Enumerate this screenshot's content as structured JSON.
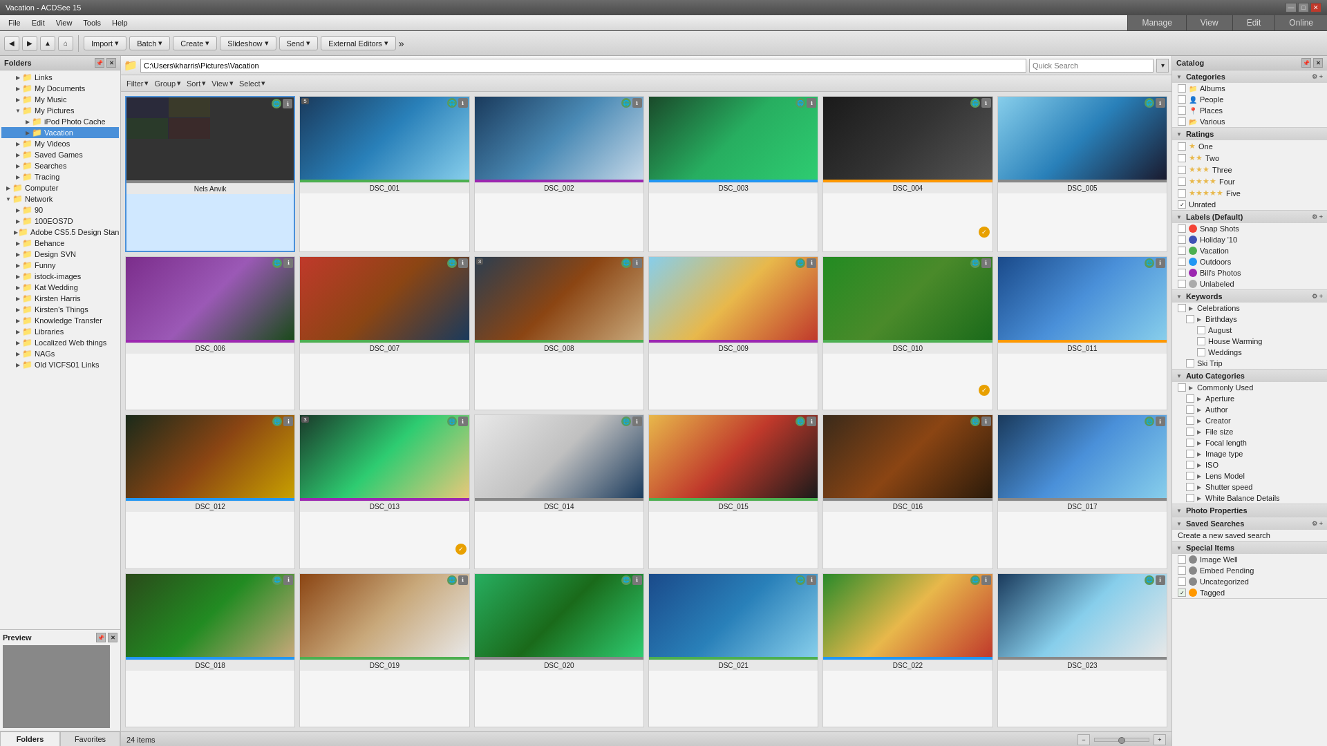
{
  "app": {
    "title": "Vacation - ACDSee 15",
    "mode_buttons": [
      "Manage",
      "View",
      "Edit",
      "Online"
    ]
  },
  "menu": {
    "items": [
      "File",
      "Edit",
      "View",
      "Tools",
      "Help"
    ]
  },
  "toolbar": {
    "nav_back": "◀",
    "nav_forward": "▶",
    "nav_up": "▲",
    "import_label": "Import",
    "batch_label": "Batch",
    "create_label": "Create",
    "slideshow_label": "Slideshow",
    "send_label": "Send",
    "external_label": "External Editors"
  },
  "path_bar": {
    "path": "C:\\Users\\kharris\\Pictures\\Vacation",
    "search_placeholder": "Quick Search"
  },
  "filter_bar": {
    "filter": "Filter",
    "group": "Group",
    "sort": "Sort",
    "view": "View",
    "select": "Select"
  },
  "left_panel": {
    "title": "Folders",
    "tree_items": [
      {
        "label": "Links",
        "indent": 1,
        "expanded": false
      },
      {
        "label": "My Documents",
        "indent": 1,
        "expanded": false
      },
      {
        "label": "My Music",
        "indent": 1,
        "expanded": false
      },
      {
        "label": "My Pictures",
        "indent": 1,
        "expanded": true
      },
      {
        "label": "iPod Photo Cache",
        "indent": 2,
        "expanded": false
      },
      {
        "label": "Vacation",
        "indent": 2,
        "expanded": false,
        "selected": true
      },
      {
        "label": "My Videos",
        "indent": 1,
        "expanded": false
      },
      {
        "label": "Saved Games",
        "indent": 1,
        "expanded": false
      },
      {
        "label": "Searches",
        "indent": 1,
        "expanded": false
      },
      {
        "label": "Tracing",
        "indent": 1,
        "expanded": false
      },
      {
        "label": "Computer",
        "indent": 0,
        "expanded": false
      },
      {
        "label": "Network",
        "indent": 0,
        "expanded": true
      },
      {
        "label": "90",
        "indent": 1,
        "expanded": false
      },
      {
        "label": "100EOS7D",
        "indent": 1,
        "expanded": false
      },
      {
        "label": "Adobe CS5.5 Design Stan",
        "indent": 1,
        "expanded": false
      },
      {
        "label": "Behance",
        "indent": 1,
        "expanded": false
      },
      {
        "label": "Design SVN",
        "indent": 1,
        "expanded": false
      },
      {
        "label": "Funny",
        "indent": 1,
        "expanded": false
      },
      {
        "label": "istock-images",
        "indent": 1,
        "expanded": false
      },
      {
        "label": "Kat Wedding",
        "indent": 1,
        "expanded": false
      },
      {
        "label": "Kirsten Harris",
        "indent": 1,
        "expanded": false
      },
      {
        "label": "Kirsten's Things",
        "indent": 1,
        "expanded": false
      },
      {
        "label": "Knowledge Transfer",
        "indent": 1,
        "expanded": false
      },
      {
        "label": "Libraries",
        "indent": 1,
        "expanded": false
      },
      {
        "label": "Localized Web things",
        "indent": 1,
        "expanded": false
      },
      {
        "label": "NAGs",
        "indent": 1,
        "expanded": false
      },
      {
        "label": "Old VICFS01 Links",
        "indent": 1,
        "expanded": false
      }
    ],
    "tabs": [
      "Folders",
      "Favorites"
    ]
  },
  "preview_panel": {
    "title": "Preview"
  },
  "photos": [
    {
      "id": "p0",
      "name": "Nels Anvik",
      "thumb_class": "thumb-collage",
      "has_badge": false,
      "badge_num": null,
      "color_bar": "#888",
      "selected": true
    },
    {
      "id": "p1",
      "name": "DSC_001",
      "thumb_class": "thumb-2",
      "has_badge": true,
      "badge_num": "5",
      "color_bar": "#4caf50"
    },
    {
      "id": "p2",
      "name": "DSC_002",
      "thumb_class": "thumb-3",
      "has_badge": false,
      "badge_num": null,
      "color_bar": "#9c27b0"
    },
    {
      "id": "p3",
      "name": "DSC_003",
      "thumb_class": "thumb-4",
      "has_badge": false,
      "badge_num": null,
      "color_bar": "#2196f3"
    },
    {
      "id": "p4",
      "name": "DSC_004",
      "thumb_class": "thumb-5",
      "has_badge": false,
      "badge_num": null,
      "color_bar": "#ff9800",
      "has_check": true
    },
    {
      "id": "p5",
      "name": "DSC_005",
      "thumb_class": "thumb-6",
      "has_badge": false,
      "badge_num": null,
      "color_bar": "#888"
    },
    {
      "id": "p6",
      "name": "DSC_006",
      "thumb_class": "thumb-7",
      "has_badge": false,
      "badge_num": null,
      "color_bar": "#9c27b0"
    },
    {
      "id": "p7",
      "name": "DSC_007",
      "thumb_class": "thumb-8",
      "has_badge": false,
      "badge_num": null,
      "color_bar": "#4caf50"
    },
    {
      "id": "p8",
      "name": "DSC_008",
      "thumb_class": "thumb-9",
      "has_badge": true,
      "badge_num": "3",
      "color_bar": "#4caf50"
    },
    {
      "id": "p9",
      "name": "DSC_009",
      "thumb_class": "thumb-10",
      "has_badge": false,
      "badge_num": null,
      "color_bar": "#9c27b0"
    },
    {
      "id": "p10",
      "name": "DSC_010",
      "thumb_class": "thumb-11",
      "has_badge": false,
      "badge_num": null,
      "color_bar": "#4caf50",
      "has_check": true
    },
    {
      "id": "p11",
      "name": "DSC_011",
      "thumb_class": "thumb-12",
      "has_badge": false,
      "badge_num": null,
      "color_bar": "#ff9800"
    },
    {
      "id": "p12",
      "name": "DSC_012",
      "thumb_class": "thumb-13",
      "has_badge": false,
      "badge_num": null,
      "color_bar": "#2196f3"
    },
    {
      "id": "p13",
      "name": "DSC_013",
      "thumb_class": "thumb-14",
      "has_badge": true,
      "badge_num": "3",
      "color_bar": "#9c27b0",
      "has_check": true
    },
    {
      "id": "p14",
      "name": "DSC_014",
      "thumb_class": "thumb-15",
      "has_badge": false,
      "badge_num": null,
      "color_bar": "#888"
    },
    {
      "id": "p15",
      "name": "DSC_015",
      "thumb_class": "thumb-16",
      "has_badge": false,
      "badge_num": null,
      "color_bar": "#4caf50"
    },
    {
      "id": "p16",
      "name": "DSC_016",
      "thumb_class": "thumb-17",
      "has_badge": false,
      "badge_num": null,
      "color_bar": "#888"
    },
    {
      "id": "p17",
      "name": "DSC_017",
      "thumb_class": "thumb-18",
      "has_badge": false,
      "badge_num": null,
      "color_bar": "#888"
    },
    {
      "id": "p18",
      "name": "DSC_018",
      "thumb_class": "thumb-19",
      "has_badge": false,
      "badge_num": null,
      "color_bar": "#2196f3"
    },
    {
      "id": "p19",
      "name": "DSC_019",
      "thumb_class": "thumb-20",
      "has_badge": false,
      "badge_num": null,
      "color_bar": "#4caf50"
    },
    {
      "id": "p20",
      "name": "DSC_020",
      "thumb_class": "thumb-21",
      "has_badge": false,
      "badge_num": null,
      "color_bar": "#888"
    },
    {
      "id": "p21",
      "name": "DSC_021",
      "thumb_class": "thumb-22",
      "has_badge": false,
      "badge_num": null,
      "color_bar": "#4caf50"
    },
    {
      "id": "p22",
      "name": "DSC_022",
      "thumb_class": "thumb-23",
      "has_badge": false,
      "badge_num": null,
      "color_bar": "#2196f3"
    },
    {
      "id": "p23",
      "name": "DSC_023",
      "thumb_class": "thumb-24",
      "has_badge": false,
      "badge_num": null,
      "color_bar": "#888"
    }
  ],
  "right_panel": {
    "title": "Catalog",
    "sections": {
      "categories": {
        "label": "Categories",
        "items": [
          "Albums",
          "People",
          "Places",
          "Various"
        ]
      },
      "ratings": {
        "label": "Ratings",
        "items": [
          {
            "num": "1",
            "label": "One"
          },
          {
            "num": "2",
            "label": "Two"
          },
          {
            "num": "3",
            "label": "Three"
          },
          {
            "num": "4",
            "label": "Four"
          },
          {
            "num": "5",
            "label": "Five"
          },
          {
            "num": "✓",
            "label": "Unrated"
          }
        ]
      },
      "labels": {
        "label": "Labels (Default)",
        "items": [
          {
            "color": "#f44336",
            "label": "Snap Shots"
          },
          {
            "color": "#3f51b5",
            "label": "Holiday '10"
          },
          {
            "color": "#4caf50",
            "label": "Vacation"
          },
          {
            "color": "#2196f3",
            "label": "Outdoors"
          },
          {
            "color": "#9c27b0",
            "label": "Bill's Photos"
          },
          {
            "color": "#888",
            "label": "Unlabeled"
          }
        ]
      },
      "keywords": {
        "label": "Keywords",
        "items": [
          {
            "label": "Celebrations",
            "indent": 0
          },
          {
            "label": "Birthdays",
            "indent": 1
          },
          {
            "label": "August",
            "indent": 2
          },
          {
            "label": "House Warming",
            "indent": 2
          },
          {
            "label": "Weddings",
            "indent": 2
          },
          {
            "label": "Ski Trip",
            "indent": 1
          }
        ]
      },
      "auto_categories": {
        "label": "Auto Categories",
        "items": [
          {
            "label": "Commonly Used",
            "indent": 0
          },
          {
            "label": "Aperture",
            "indent": 1
          },
          {
            "label": "Author",
            "indent": 1
          },
          {
            "label": "Creator",
            "indent": 1
          },
          {
            "label": "File size",
            "indent": 1
          },
          {
            "label": "Focal length",
            "indent": 1
          },
          {
            "label": "Image type",
            "indent": 1
          },
          {
            "label": "ISO",
            "indent": 1
          },
          {
            "label": "Lens Model",
            "indent": 1
          },
          {
            "label": "Shutter speed",
            "indent": 1
          },
          {
            "label": "White Balance Details",
            "indent": 1
          }
        ]
      },
      "photo_properties": {
        "label": "Photo Properties"
      },
      "saved_searches": {
        "label": "Saved Searches",
        "items": [
          "Create a new saved search"
        ]
      },
      "special_items": {
        "label": "Special Items",
        "items": [
          {
            "label": "Image Well",
            "color": "#888"
          },
          {
            "label": "Embed Pending",
            "color": "#888"
          },
          {
            "label": "Uncategorized",
            "color": "#888"
          },
          {
            "label": "Tagged",
            "color": "#ff9800"
          }
        ]
      }
    }
  },
  "status_bar": {
    "item_count": "24 items"
  }
}
